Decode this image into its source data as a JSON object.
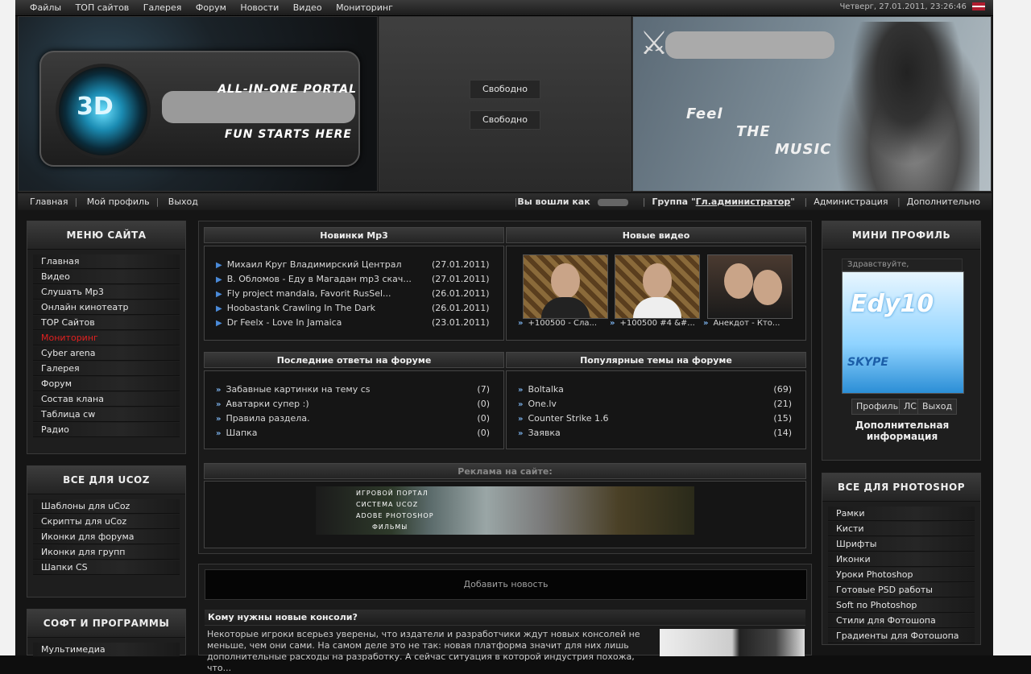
{
  "topbar": {
    "nav": [
      "Файлы",
      "ТОП сайтов",
      "Галерея",
      "Форум",
      "Новости",
      "Видео",
      "Мониторинг"
    ],
    "datetime": "Четверг, 27.01.2011, 23:26:46"
  },
  "header": {
    "logo_mark": "3D",
    "logo_line1": "ALL-IN-ONE PORTAL",
    "logo_line2": "FUN STARTS HERE",
    "slot1": "Свободно",
    "slot2": "Свободно",
    "feel1": "Feel",
    "feel2": "THE",
    "feel3": "MUSIC"
  },
  "subbar": {
    "left": [
      "Главная",
      "Мой профиль",
      "Выход"
    ],
    "logged_as_label": "Вы вошли как",
    "group_label": "Группа",
    "group_value": "Гл.администратор",
    "admin": "Администрация",
    "more": "Дополнительно"
  },
  "left_menu": {
    "title": "МЕНЮ САЙТА",
    "items": [
      "Главная",
      "Видео",
      "Слушать Mp3",
      "Онлайн кинотеатр",
      "TOP Сайтов",
      "Мониторинг",
      "Cyber arena",
      "Галерея",
      "Форум",
      "Состав клана",
      "Таблица cw",
      "Радио"
    ],
    "active_index": 5
  },
  "ucoz_menu": {
    "title": "ВСЕ ДЛЯ UCOZ",
    "items": [
      "Шаблоны для uCoz",
      "Скрипты для uCoz",
      "Иконки для форума",
      "Иконки для групп",
      "Шапки CS"
    ]
  },
  "soft_menu": {
    "title": "СОФТ И ПРОГРАММЫ",
    "items": [
      "Мультимедиа"
    ]
  },
  "mp3": {
    "title": "Новинки Mp3",
    "items": [
      {
        "text": "Михаил Круг Владимирский Централ",
        "date": "(27.01.2011)"
      },
      {
        "text": "В. Обломов - Еду в Магадан mp3 скач...",
        "date": "(27.01.2011)"
      },
      {
        "text": "Fly project mandala, Favorit RusSel...",
        "date": "(26.01.2011)"
      },
      {
        "text": "Hoobastank Crawling In The Dark",
        "date": "(26.01.2011)"
      },
      {
        "text": "Dr Feelx - Love In Jamaica",
        "date": "(23.01.2011)"
      }
    ]
  },
  "video": {
    "title": "Новые видео",
    "items": [
      "+100500 - Сла...",
      "+100500 #4 &#...",
      "Анекдот - Кто..."
    ]
  },
  "forum_last": {
    "title": "Последние ответы на форуме",
    "items": [
      {
        "text": "Забавные картинки на тему cs",
        "count": "(7)"
      },
      {
        "text": "Аватарки супер :)",
        "count": "(0)"
      },
      {
        "text": "Правила раздела.",
        "count": "(0)"
      },
      {
        "text": "Шапка",
        "count": "(0)"
      }
    ]
  },
  "forum_popular": {
    "title": "Популярные темы на форуме",
    "items": [
      {
        "text": "Boltalka",
        "count": "(69)"
      },
      {
        "text": "One.lv",
        "count": "(21)"
      },
      {
        "text": "Counter Strike 1.6",
        "count": "(15)"
      },
      {
        "text": "Заявка",
        "count": "(14)"
      }
    ]
  },
  "ads": {
    "title": "Реклама на сайте:",
    "lines": [
      "ИГРОВОЙ ПОРТАЛ",
      "СИСТЕМА UCOZ",
      "ADOBE PHOTOSHOP",
      "ФИЛЬМЫ"
    ]
  },
  "news": {
    "add_label": "Добавить новость",
    "title": "Кому нужны новые консоли?",
    "text": "Некоторые игроки всерьез уверены, что издатели и разработчики ждут новых консолей не меньше, чем они сами. На самом деле это не так: новая платформа значит для них лишь дополнительные расходы на разработку. А сейчас ситуация в которой индустрия похожа, что..."
  },
  "mini_profile": {
    "title": "МИНИ ПРОФИЛЬ",
    "hello": "Здравствуйте,",
    "avatar_text": "Edy10",
    "avatar_sub": "SKYPE",
    "buttons": [
      "Профиль",
      "ЛС",
      "Выход"
    ],
    "extra": "Дополнительная информация"
  },
  "ps_menu": {
    "title": "ВСЕ ДЛЯ PHOTOSHOP",
    "items": [
      "Рамки",
      "Кисти",
      "Шрифты",
      "Иконки",
      "Уроки Photoshop",
      "Готовые PSD работы",
      "Soft по Photoshop",
      "Стили для Фотошопа",
      "Градиенты для Фотошопа"
    ]
  }
}
